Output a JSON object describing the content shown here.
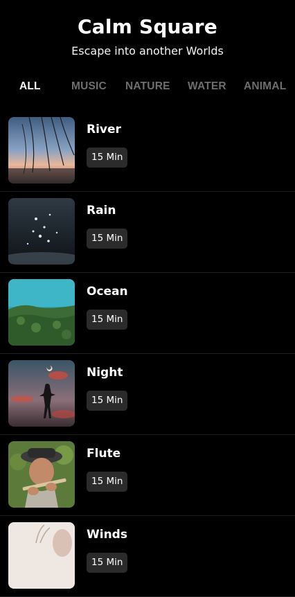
{
  "app": {
    "title": "Calm Square",
    "subtitle": "Escape into another Worlds"
  },
  "tabs": [
    {
      "label": "ALL",
      "active": true
    },
    {
      "label": "MUSIC",
      "active": false
    },
    {
      "label": "NATURE",
      "active": false
    },
    {
      "label": "WATER",
      "active": false
    },
    {
      "label": "ANIMAL",
      "active": false
    }
  ],
  "items": [
    {
      "title": "River",
      "duration": "15 Min",
      "thumbnail": "river-sunset-photo"
    },
    {
      "title": "Rain",
      "duration": "15 Min",
      "thumbnail": "rain-drops-photo"
    },
    {
      "title": "Ocean",
      "duration": "15 Min",
      "thumbnail": "ocean-forest-aerial-photo"
    },
    {
      "title": "Night",
      "duration": "15 Min",
      "thumbnail": "night-silhouette-photo"
    },
    {
      "title": "Flute",
      "duration": "15 Min",
      "thumbnail": "flute-player-photo"
    },
    {
      "title": "Winds",
      "duration": "15 Min",
      "thumbnail": "winds-light-photo"
    }
  ]
}
